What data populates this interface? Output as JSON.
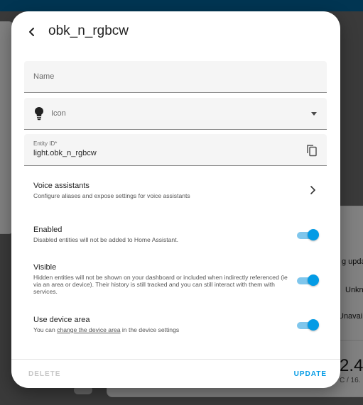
{
  "background": {
    "right_texts": [
      "g upda",
      "Unkn",
      "Unavail",
      "2.4",
      "C / 16."
    ]
  },
  "dialog": {
    "title": "obk_n_rgbcw",
    "name_field": {
      "label": "Name"
    },
    "icon_field": {
      "label": "Icon",
      "icon": "lightbulb-icon"
    },
    "entity_id_field": {
      "label": "Entity ID*",
      "value": "light.obk_n_rgbcw"
    },
    "voice_assistants": {
      "title": "Voice assistants",
      "subtitle": "Configure aliases and expose settings for voice assistants"
    },
    "enabled": {
      "title": "Enabled",
      "subtitle": "Disabled entities will not be added to Home Assistant.",
      "on": true
    },
    "visible": {
      "title": "Visible",
      "subtitle": "Hidden entities will not be shown on your dashboard or included when indirectly referenced (ie via an area or device). Their history is still tracked and you can still interact with them with services.",
      "on": true
    },
    "use_device_area": {
      "title": "Use device area",
      "subtitle_prefix": "You can ",
      "subtitle_link": "change the device area",
      "subtitle_suffix": " in the device settings",
      "on": true
    },
    "footer": {
      "delete_label": "DELETE",
      "update_label": "UPDATE"
    }
  },
  "colors": {
    "accent": "#039be5",
    "toggle_track": "#7fc6ec",
    "header_bar": "#03669e"
  }
}
